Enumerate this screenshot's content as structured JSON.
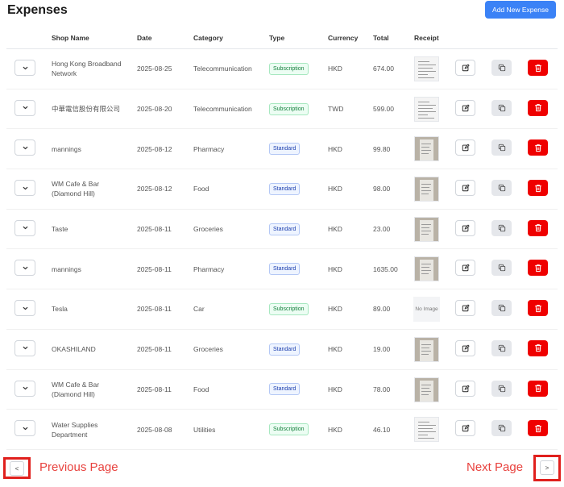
{
  "page": {
    "title": "Expenses",
    "add_button": "Add New Expense"
  },
  "columns": {
    "shop": "Shop Name",
    "date": "Date",
    "category": "Category",
    "type": "Type",
    "currency": "Currency",
    "total": "Total",
    "receipt": "Receipt"
  },
  "colors": {
    "accent": "#3b82f6",
    "delete": "#ef0000",
    "annotation": "#e0201d"
  },
  "receipt_no_image": "No Image",
  "rows": [
    {
      "shop": "Hong Kong Broadband\nNetwork",
      "date": "2025-08-25",
      "category": "Telecommunication",
      "type": "Subscription",
      "currency": "HKD",
      "total": "674.00",
      "receipt": "document"
    },
    {
      "shop": "中華電信股份有限公司",
      "date": "2025-08-20",
      "category": "Telecommunication",
      "type": "Subscription",
      "currency": "TWD",
      "total": "599.00",
      "receipt": "document"
    },
    {
      "shop": "mannings",
      "date": "2025-08-12",
      "category": "Pharmacy",
      "type": "Standard",
      "currency": "HKD",
      "total": "99.80",
      "receipt": "photo"
    },
    {
      "shop": "WM Cafe & Bar\n(Diamond Hill)",
      "date": "2025-08-12",
      "category": "Food",
      "type": "Standard",
      "currency": "HKD",
      "total": "98.00",
      "receipt": "photo"
    },
    {
      "shop": "Taste",
      "date": "2025-08-11",
      "category": "Groceries",
      "type": "Standard",
      "currency": "HKD",
      "total": "23.00",
      "receipt": "photo"
    },
    {
      "shop": "mannings",
      "date": "2025-08-11",
      "category": "Pharmacy",
      "type": "Standard",
      "currency": "HKD",
      "total": "1635.00",
      "receipt": "photo"
    },
    {
      "shop": "Tesla",
      "date": "2025-08-11",
      "category": "Car",
      "type": "Subscription",
      "currency": "HKD",
      "total": "89.00",
      "receipt": "none"
    },
    {
      "shop": "OKASHILAND",
      "date": "2025-08-11",
      "category": "Groceries",
      "type": "Standard",
      "currency": "HKD",
      "total": "19.00",
      "receipt": "photo"
    },
    {
      "shop": "WM Cafe & Bar\n(Diamond Hill)",
      "date": "2025-08-11",
      "category": "Food",
      "type": "Standard",
      "currency": "HKD",
      "total": "78.00",
      "receipt": "photo"
    },
    {
      "shop": "Water Supplies\nDepartment",
      "date": "2025-08-08",
      "category": "Utilities",
      "type": "Subscription",
      "currency": "HKD",
      "total": "46.10",
      "receipt": "document"
    }
  ],
  "pagination": {
    "prev_symbol": "<",
    "next_symbol": ">",
    "prev_label": "Previous Page",
    "next_label": "Next Page"
  }
}
